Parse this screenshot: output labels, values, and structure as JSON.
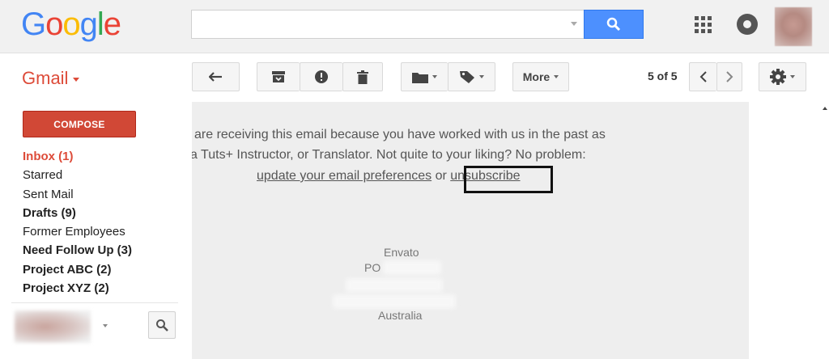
{
  "header": {
    "logo_letters": [
      {
        "ch": "G",
        "color": "#4285F4"
      },
      {
        "ch": "o",
        "color": "#EA4335"
      },
      {
        "ch": "o",
        "color": "#FBBC05"
      },
      {
        "ch": "g",
        "color": "#4285F4"
      },
      {
        "ch": "l",
        "color": "#34A853"
      },
      {
        "ch": "e",
        "color": "#EA4335"
      }
    ],
    "search": {
      "value": "",
      "placeholder": ""
    },
    "icons": [
      "search-icon",
      "apps-grid-icon",
      "notifications-icon",
      "account-avatar"
    ]
  },
  "toolbar": {
    "product_label": "Gmail",
    "back_icon": "back-arrow-icon",
    "archive_icon": "archive-icon",
    "spam_icon": "report-spam-icon",
    "delete_icon": "trash-icon",
    "move_icon": "folder-icon",
    "labels_icon": "label-icon",
    "more_label": "More",
    "pager": "5 of 5",
    "settings_icon": "gear-icon"
  },
  "sidebar": {
    "compose_label": "COMPOSE",
    "items": [
      {
        "label": "Inbox (1)",
        "style": "active"
      },
      {
        "label": "Starred",
        "style": "normal"
      },
      {
        "label": "Sent Mail",
        "style": "normal"
      },
      {
        "label": "Drafts (9)",
        "style": "bold"
      },
      {
        "label": "Former Employees",
        "style": "normal"
      },
      {
        "label": "Need Follow Up (3)",
        "style": "bold"
      },
      {
        "label": "Project ABC (2)",
        "style": "bold"
      },
      {
        "label": "Project XYZ (2)",
        "style": "bold"
      }
    ]
  },
  "email": {
    "line1": "are receiving this email because you have worked with us in the past as",
    "line2": "a Tuts+ Instructor, or Translator. Not quite to your liking? No problem:",
    "preferences_link": "update your email preferences",
    "or_text": " or ",
    "unsubscribe_link": "unsubscribe",
    "address_company": "Envato",
    "address_po": "PO",
    "address_country": "Australia"
  },
  "colors": {
    "brand_red": "#dd4b39",
    "compose_red": "#d14836",
    "search_blue": "#4d90fe"
  }
}
